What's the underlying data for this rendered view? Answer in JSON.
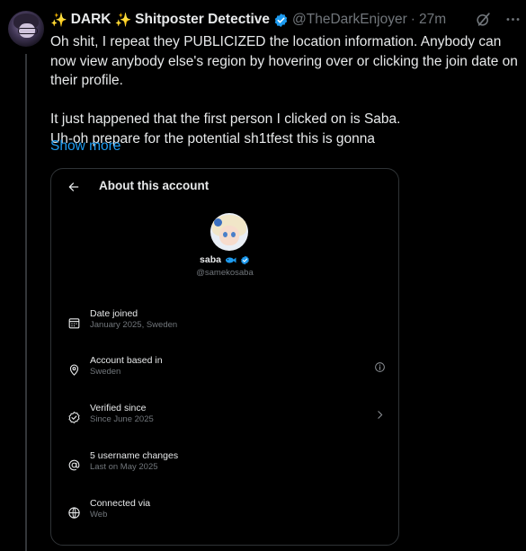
{
  "tweet": {
    "sparkle_left": "✨",
    "name_part1": "DARK",
    "sparkle_mid": "✨",
    "name_part2": "Shitposter Detective",
    "handle": "@TheDarkEnjoyer",
    "separator": "·",
    "time": "27m",
    "paragraph1": "Oh shit, I repeat they PUBLICIZED the location information. Anybody can now view anybody else's region by hovering over or clicking the join date on their profile.",
    "paragraph2_line1": "It just happened that the first person I clicked on is Saba.",
    "paragraph2_line2": "Uh-oh prepare for the potential sh1tfest this is gonna",
    "show_more": "Show more",
    "icons": [
      "grok-icon",
      "more-icon"
    ]
  },
  "embedded": {
    "title": "About this account",
    "profile_name": "saba",
    "profile_handle": "@samekosaba",
    "rows": [
      {
        "icon": "calendar-icon",
        "title": "Date joined",
        "sub": "January 2025, Sweden"
      },
      {
        "icon": "location-pin-icon",
        "title": "Account based in",
        "sub": "Sweden"
      },
      {
        "icon": "verified-check-icon",
        "title": "Verified since",
        "sub": "Since June 2025"
      },
      {
        "icon": "at-sign-icon",
        "title": "5 username changes",
        "sub": "Last on May 2025"
      },
      {
        "icon": "globe-icon",
        "title": "Connected via",
        "sub": "Web"
      }
    ]
  },
  "colors": {
    "background": "#000000",
    "text": "#e7e9ea",
    "muted": "#71767b",
    "link": "#1d9bf0",
    "verified": "#1d9bf0",
    "border": "#2f3336"
  }
}
